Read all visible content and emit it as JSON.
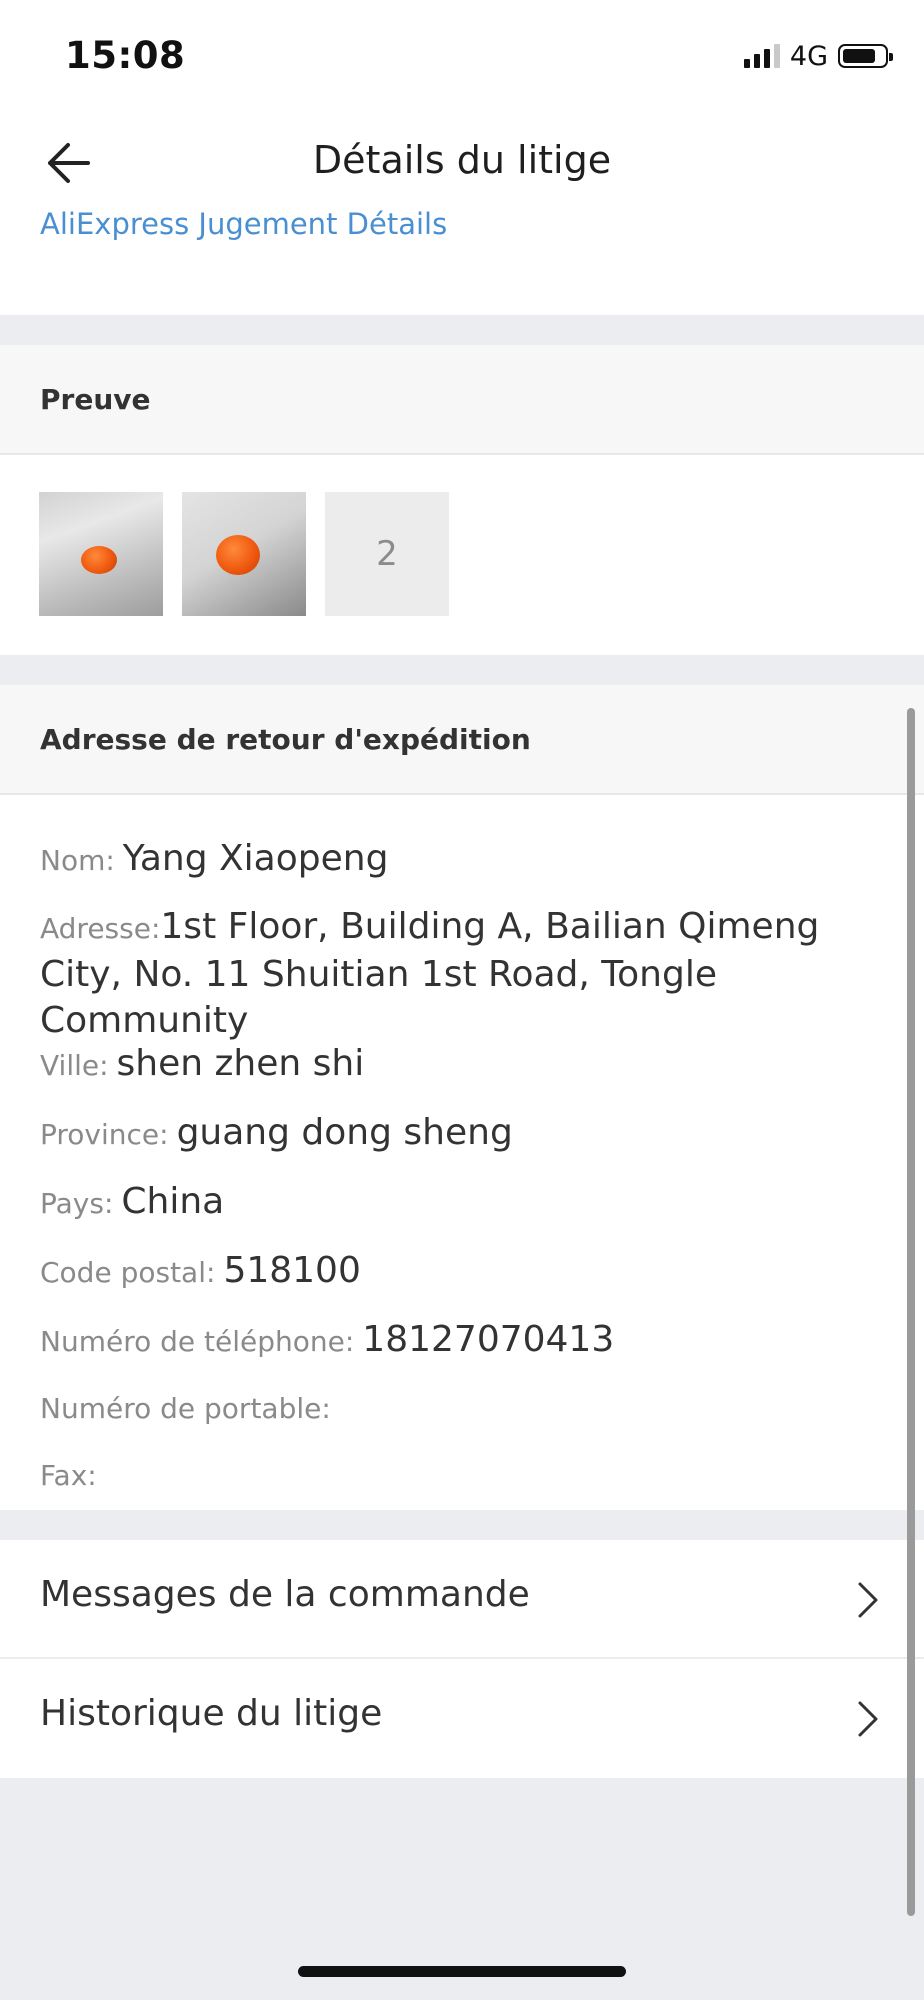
{
  "status_bar": {
    "time": "15:08",
    "network": "4G",
    "battery_level": 0.75,
    "signal_bars_active": 3
  },
  "header": {
    "title": "Détails du litige",
    "back_icon": "arrow-left-icon",
    "judgement_link": "AliExpress Jugement Détails"
  },
  "proof": {
    "title": "Preuve",
    "more_count": "2",
    "thumbnails": [
      "photo",
      "photo"
    ]
  },
  "return_address": {
    "title": "Adresse de retour d'expédition",
    "name_label": "Nom:",
    "name_value": "Yang Xiaopeng",
    "address_label": "Adresse:",
    "address_value": "1st Floor, Building A, Bailian Qimeng City, No. 11 Shuitian 1st Road, Tongle Community",
    "city_label": "Ville:",
    "city_value": "shen zhen shi",
    "province_label": "Province:",
    "province_value": "guang dong sheng",
    "country_label": "Pays:",
    "country_value": "China",
    "postal_label": "Code postal:",
    "postal_value": "518100",
    "phone_label": "Numéro de téléphone:",
    "phone_value": "18127070413",
    "mobile_label": "Numéro de portable:",
    "mobile_value": "",
    "fax_label": "Fax:",
    "fax_value": ""
  },
  "nav": {
    "messages": "Messages de la commande",
    "history": "Historique du litige",
    "chevron_icon": "chevron-right-icon"
  },
  "colors": {
    "link": "#4a8fd1",
    "page_bg": "#ecedf0",
    "section_header_bg": "#f7f7f8",
    "proof_accent": "#f05a10"
  }
}
